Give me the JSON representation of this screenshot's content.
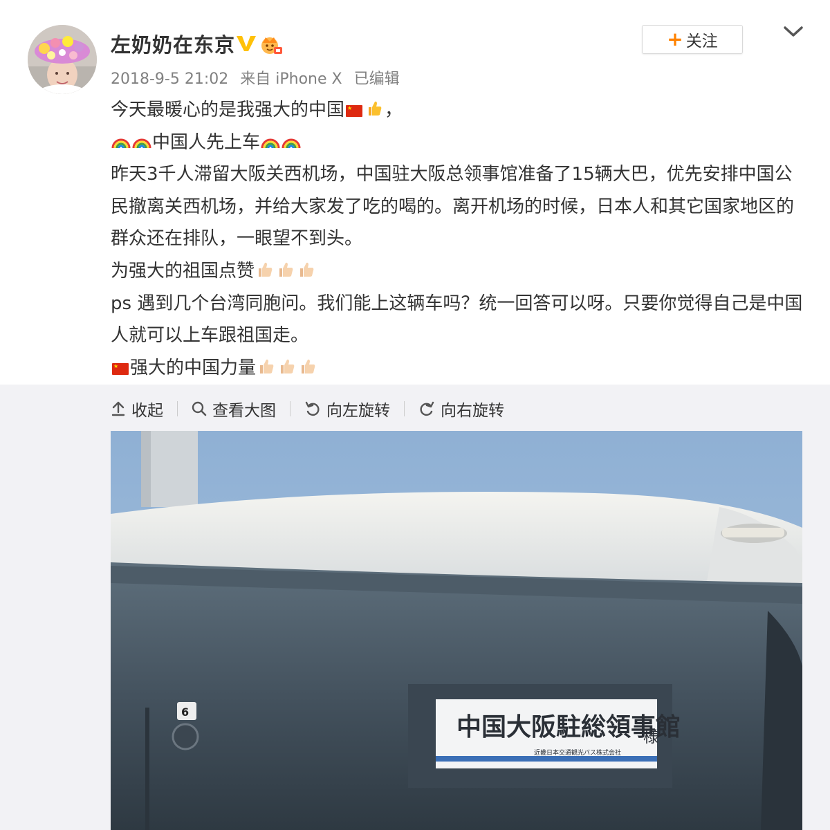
{
  "user": {
    "name": "左奶奶在东京"
  },
  "follow": {
    "plus": "+",
    "label": "关注"
  },
  "meta": {
    "time": "2018-9-5 21:02",
    "source": "来自 iPhone X",
    "edited": "已编辑"
  },
  "post": {
    "line1": "今天最暖心的是我强大的中国",
    "line1_end": "，",
    "line2": "中国人先上车",
    "line3": "昨天3千人滞留大阪关西机场，中国驻大阪总领事馆准备了15辆大巴，优先安排中国公民撤离关西机场，并给大家发了吃的喝的。离开机场的时候，日本人和其它国家地区的群众还在排队，一眼望不到头。",
    "line4": "为强大的祖国点赞",
    "line5": "ps 遇到几个台湾同胞问。我们能上这辆车吗？统一回答可以呀。只要你觉得自己是中国人就可以上车跟祖国走。",
    "line6": "强大的中国力量"
  },
  "toolbar": {
    "collapse": "收起",
    "view_large": "查看大图",
    "rotate_left": "向左旋转",
    "rotate_right": "向右旋转"
  },
  "photo": {
    "sign_text": "中国大阪駐総領事館",
    "sign_suffix": "様",
    "sign_small": "近畿日本交通観光バス株式会社",
    "number_sticker": "6"
  },
  "icons": {
    "flag": "china-flag-icon",
    "thumb": "thumbs-up-icon",
    "rainbow": "rainbow-icon",
    "verified": "verified-v-icon",
    "vip": "vip-crown-icon"
  },
  "colors": {
    "accent": "#ff8200",
    "verified": "#ffc107",
    "text": "#333333",
    "meta": "#808080",
    "flag_red": "#de2910"
  }
}
